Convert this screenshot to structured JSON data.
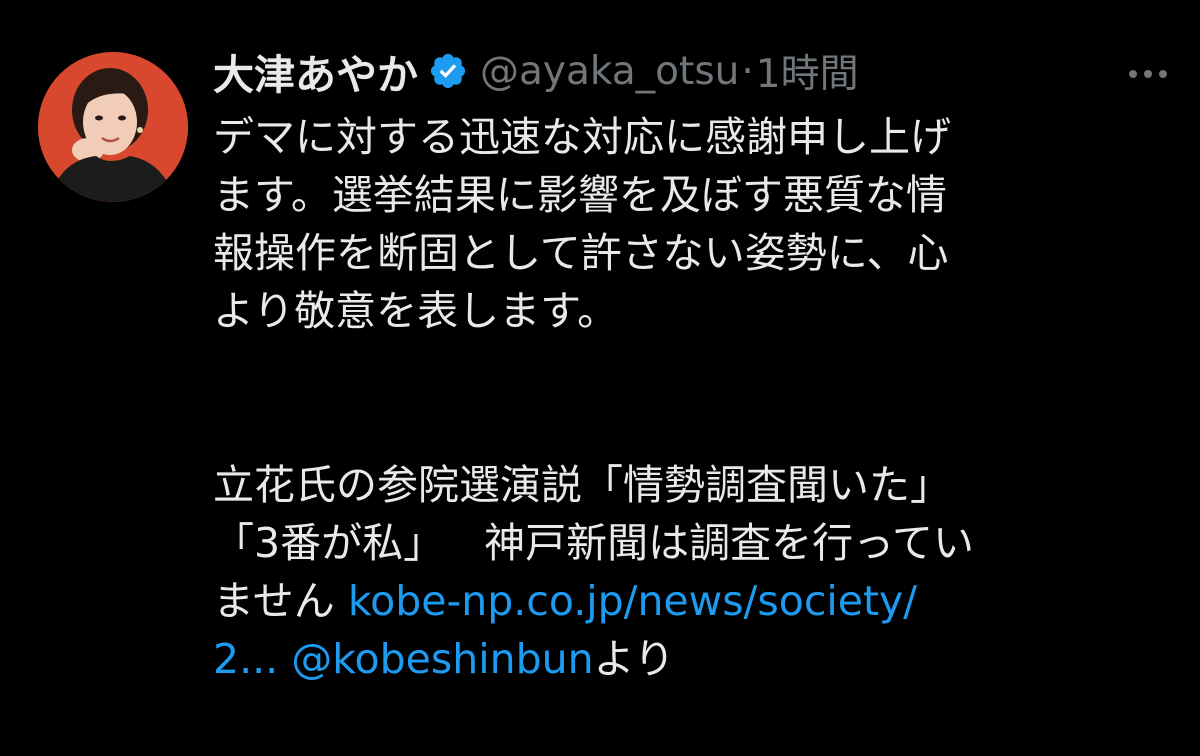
{
  "tweet": {
    "author": {
      "display_name": "大津あやか",
      "verified_icon": "verified-badge-icon",
      "handle": "@ayaka_otsu",
      "separator": "·",
      "time": "1時間"
    },
    "more_icon": "more-options-icon",
    "text": {
      "line1": "デマに対する迅速な対応に感謝申し上げ",
      "line2": "ます。選挙結果に影響を及ぼす悪質な情",
      "line3": "報操作を断固として許さない姿勢に、心",
      "line4": "より敬意を表します。",
      "line5": "立花氏の参院選演説「情勢調査聞いた」",
      "line6a": "「3番が私」",
      "line6b": "神戸新聞は調査を行ってい",
      "line7a": "ません",
      "link_url": "kobe-np.co.jp/news/society/",
      "link_url_cont": "2...",
      "mention": "@kobeshinbun",
      "mention_suffix": "より"
    },
    "colors": {
      "background": "#000000",
      "text": "#e7e9ea",
      "secondary": "#71767b",
      "link": "#1d9bf0",
      "verified": "#1d9bf0"
    }
  }
}
